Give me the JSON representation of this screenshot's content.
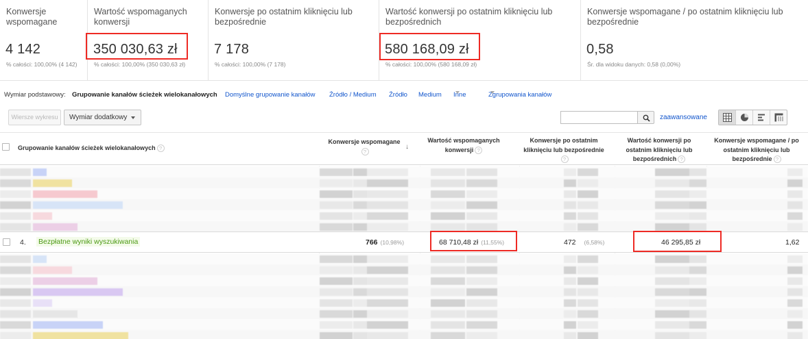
{
  "scorecards": [
    {
      "title": "Konwersje wspomagane",
      "value": "4 142",
      "sub": "% całości: 100,00% (4 142)"
    },
    {
      "title": "Wartość wspomaganych konwersji",
      "value": "350 030,63 zł",
      "sub": "% całości: 100,00% (350 030,63 zł)"
    },
    {
      "title": "Konwersje po ostatnim kliknięciu lub bezpośrednie",
      "value": "7 178",
      "sub": "% całości: 100,00% (7 178)"
    },
    {
      "title": "Wartość konwersji po ostatnim kliknięciu lub bezpośrednich",
      "value": "580 168,09 zł",
      "sub": "% całości: 100,00% (580 168,09 zł)"
    },
    {
      "title": "Konwersje wspomagane / po ostatnim kliknięciu lub bezpośrednie",
      "value": "0,58",
      "sub": "Śr. dla widoku danych: 0,58 (0,00%)"
    }
  ],
  "dimensions": {
    "label": "Wymiar podstawowy:",
    "active": "Grupowanie kanałów ścieżek wielokanałowych",
    "links": [
      "Domyślne grupowanie kanałów",
      "Źródło / Medium",
      "Źródło",
      "Medium",
      "Inne",
      "Zgrupowania kanałów"
    ]
  },
  "toolbar": {
    "plot_rows": "Wiersze wykresu",
    "secondary_dimension": "Wymiar dodatkowy",
    "search_value": "",
    "advanced": "zaawansowane"
  },
  "table": {
    "dimension_header": "Grupowanie kanałów ścieżek wielokanałowych",
    "columns": [
      "Konwersje wspomagane",
      "Wartość wspomaganych konwersji",
      "Konwersje po ostatnim kliknięciu lub bezpośrednie",
      "Wartość konwersji po ostatnim kliknięciu lub bezpośrednich",
      "Konwersje wspomagane / po ostatnim kliknięciu lub bezpośrednie"
    ],
    "highlighted_row": {
      "index": "4.",
      "channel": "Bezpłatne wyniki wyszukiwania",
      "assisted": "766",
      "assisted_pct": "(10,98%)",
      "assisted_value": "68 710,48 zł",
      "assisted_value_pct": "(11,55%)",
      "last_click": "472",
      "last_click_pct": "(6,58%)",
      "last_click_value": "46 295,85 zł",
      "ratio": "1,62"
    }
  },
  "colors": {
    "highlight": "#ee2a24",
    "link": "#1155cc",
    "channel_text": "#4c9a14",
    "channel_bg": "#f4fbea"
  },
  "icons": [
    "search-icon",
    "grid-view-icon",
    "pie-view-icon",
    "bar-view-icon",
    "pivot-view-icon",
    "sort-desc-icon",
    "help-icon"
  ]
}
